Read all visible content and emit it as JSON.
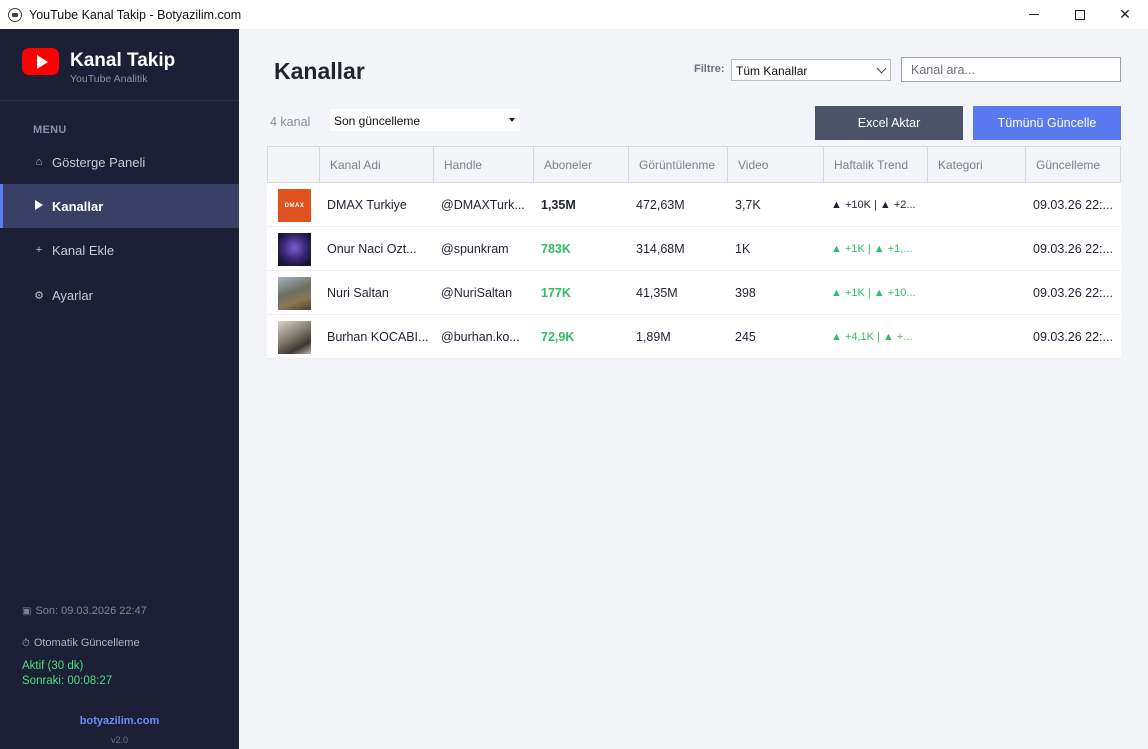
{
  "window": {
    "title": "YouTube Kanal Takip - Botyazilim.com"
  },
  "sidebar": {
    "brand_title": "Kanal Takip",
    "brand_subtitle": "YouTube Analitik",
    "menu_label": "MENU",
    "items": [
      {
        "label": "Gösterge Paneli",
        "icon": "dashboard-icon",
        "glyph": "⌂"
      },
      {
        "label": "Kanallar",
        "icon": "play-icon",
        "glyph": ""
      },
      {
        "label": "Kanal Ekle",
        "icon": "plus-icon",
        "glyph": "+"
      },
      {
        "label": "Ayarlar",
        "icon": "gear-icon",
        "glyph": "⚙"
      }
    ],
    "active_index": 1,
    "last_update": "Son: 09.03.2026 22:47",
    "auto_update_label": "Otomatik Güncelleme",
    "auto_status": "Aktif (30 dk)",
    "next_update": "Sonraki: 00:08:27",
    "site": "botyazilim.com",
    "version": "v2.0"
  },
  "main": {
    "title": "Kanallar",
    "filter_label": "Filtre:",
    "filter_value": "Tüm Kanallar",
    "search_placeholder": "Kanal ara...",
    "count": "4 kanal",
    "sort_value": "Son güncelleme",
    "export_button": "Excel Aktar",
    "update_all_button": "Tümünü Güncelle"
  },
  "table": {
    "columns": [
      "",
      "Kanal Adi",
      "Handle",
      "Aboneler",
      "Görüntülenme",
      "Video",
      "Haftalik Trend",
      "Kategori",
      "Güncelleme"
    ],
    "rows": [
      {
        "thumb": "dmax",
        "thumb_text": "DMAX",
        "name": "DMAX Turkiye",
        "handle": "@DMAXTurk...",
        "subs": "1,35M",
        "subs_style": "dark",
        "views": "472,63M",
        "videos": "3,7K",
        "trend": "▲ +10K  |  ▲ +2...",
        "trend_style": "dark",
        "category": "",
        "updated": "09.03.26 22:..."
      },
      {
        "thumb": "onur",
        "thumb_text": "",
        "name": "Onur Naci Ozt...",
        "handle": "@spunkram",
        "subs": "783K",
        "subs_style": "green",
        "views": "314,68M",
        "videos": "1K",
        "trend": "▲ +1K  |  ▲ +1,...",
        "trend_style": "green",
        "category": "",
        "updated": "09.03.26 22:..."
      },
      {
        "thumb": "nuri",
        "thumb_text": "",
        "name": "Nuri Saltan",
        "handle": "@NuriSaltan",
        "subs": "177K",
        "subs_style": "green",
        "views": "41,35M",
        "videos": "398",
        "trend": "▲ +1K  |  ▲ +10...",
        "trend_style": "green",
        "category": "",
        "updated": "09.03.26 22:..."
      },
      {
        "thumb": "burhan",
        "thumb_text": "",
        "name": "Burhan KOCABI...",
        "handle": "@burhan.ko...",
        "subs": "72,9K",
        "subs_style": "green",
        "views": "1,89M",
        "videos": "245",
        "trend": "▲ +4,1K  |  ▲ +...",
        "trend_style": "green",
        "category": "",
        "updated": "09.03.26 22:..."
      }
    ]
  },
  "colors": {
    "sidebar_bg": "#1c1f36",
    "active_item_bg": "#3a3f66",
    "accent_blue": "#5a78f0",
    "export_button_bg": "#4c5368",
    "positive_green": "#2fbf64",
    "youtube_red": "#ff0000"
  }
}
